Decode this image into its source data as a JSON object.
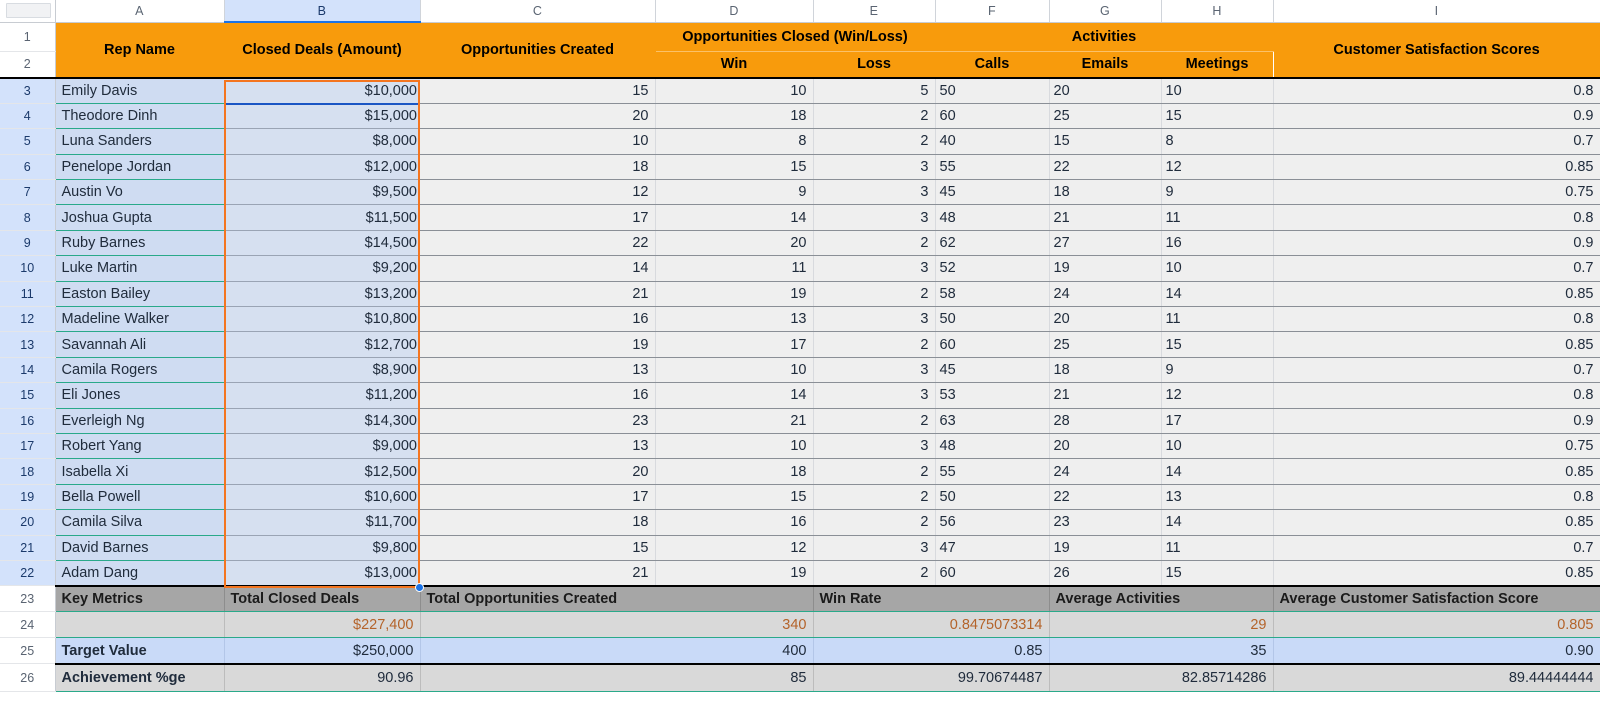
{
  "spreadsheet": {
    "column_letters": [
      "A",
      "B",
      "C",
      "D",
      "E",
      "F",
      "G",
      "H",
      "I"
    ],
    "selected_column": "B",
    "selected_range": "B3:B22",
    "active_cell": "B3",
    "accent_header_color": "#f89b0c",
    "selection_border_color": "#f4751f",
    "active_cell_color": "#1a56c4"
  },
  "headers": {
    "rep_name": "Rep Name",
    "closed_deals": "Closed Deals (Amount)",
    "opportunities_created": "Opportunities Created",
    "opportunities_closed": "Opportunities Closed (Win/Loss)",
    "win": "Win",
    "loss": "Loss",
    "activities": "Activities",
    "calls": "Calls",
    "emails": "Emails",
    "meetings": "Meetings",
    "customer_satisfaction": "Customer Satisfaction Scores"
  },
  "rows": [
    {
      "n": "3",
      "rep": "Emily Davis",
      "amount": "$10,000",
      "opps": "15",
      "win": "10",
      "loss": "5",
      "calls": "50",
      "emails": "20",
      "meetings": "10",
      "csat": "0.8"
    },
    {
      "n": "4",
      "rep": "Theodore Dinh",
      "amount": "$15,000",
      "opps": "20",
      "win": "18",
      "loss": "2",
      "calls": "60",
      "emails": "25",
      "meetings": "15",
      "csat": "0.9"
    },
    {
      "n": "5",
      "rep": "Luna Sanders",
      "amount": "$8,000",
      "opps": "10",
      "win": "8",
      "loss": "2",
      "calls": "40",
      "emails": "15",
      "meetings": "8",
      "csat": "0.7"
    },
    {
      "n": "6",
      "rep": "Penelope Jordan",
      "amount": "$12,000",
      "opps": "18",
      "win": "15",
      "loss": "3",
      "calls": "55",
      "emails": "22",
      "meetings": "12",
      "csat": "0.85"
    },
    {
      "n": "7",
      "rep": "Austin Vo",
      "amount": "$9,500",
      "opps": "12",
      "win": "9",
      "loss": "3",
      "calls": "45",
      "emails": "18",
      "meetings": "9",
      "csat": "0.75"
    },
    {
      "n": "8",
      "rep": "Joshua Gupta",
      "amount": "$11,500",
      "opps": "17",
      "win": "14",
      "loss": "3",
      "calls": "48",
      "emails": "21",
      "meetings": "11",
      "csat": "0.8"
    },
    {
      "n": "9",
      "rep": "Ruby Barnes",
      "amount": "$14,500",
      "opps": "22",
      "win": "20",
      "loss": "2",
      "calls": "62",
      "emails": "27",
      "meetings": "16",
      "csat": "0.9"
    },
    {
      "n": "10",
      "rep": "Luke Martin",
      "amount": "$9,200",
      "opps": "14",
      "win": "11",
      "loss": "3",
      "calls": "52",
      "emails": "19",
      "meetings": "10",
      "csat": "0.7"
    },
    {
      "n": "11",
      "rep": "Easton Bailey",
      "amount": "$13,200",
      "opps": "21",
      "win": "19",
      "loss": "2",
      "calls": "58",
      "emails": "24",
      "meetings": "14",
      "csat": "0.85"
    },
    {
      "n": "12",
      "rep": "Madeline Walker",
      "amount": "$10,800",
      "opps": "16",
      "win": "13",
      "loss": "3",
      "calls": "50",
      "emails": "20",
      "meetings": "11",
      "csat": "0.8"
    },
    {
      "n": "13",
      "rep": "Savannah Ali",
      "amount": "$12,700",
      "opps": "19",
      "win": "17",
      "loss": "2",
      "calls": "60",
      "emails": "25",
      "meetings": "15",
      "csat": "0.85"
    },
    {
      "n": "14",
      "rep": "Camila Rogers",
      "amount": "$8,900",
      "opps": "13",
      "win": "10",
      "loss": "3",
      "calls": "45",
      "emails": "18",
      "meetings": "9",
      "csat": "0.7"
    },
    {
      "n": "15",
      "rep": "Eli Jones",
      "amount": "$11,200",
      "opps": "16",
      "win": "14",
      "loss": "3",
      "calls": "53",
      "emails": "21",
      "meetings": "12",
      "csat": "0.8"
    },
    {
      "n": "16",
      "rep": "Everleigh Ng",
      "amount": "$14,300",
      "opps": "23",
      "win": "21",
      "loss": "2",
      "calls": "63",
      "emails": "28",
      "meetings": "17",
      "csat": "0.9"
    },
    {
      "n": "17",
      "rep": "Robert Yang",
      "amount": "$9,000",
      "opps": "13",
      "win": "10",
      "loss": "3",
      "calls": "48",
      "emails": "20",
      "meetings": "10",
      "csat": "0.75"
    },
    {
      "n": "18",
      "rep": "Isabella Xi",
      "amount": "$12,500",
      "opps": "20",
      "win": "18",
      "loss": "2",
      "calls": "55",
      "emails": "24",
      "meetings": "14",
      "csat": "0.85"
    },
    {
      "n": "19",
      "rep": "Bella Powell",
      "amount": "$10,600",
      "opps": "17",
      "win": "15",
      "loss": "2",
      "calls": "50",
      "emails": "22",
      "meetings": "13",
      "csat": "0.8"
    },
    {
      "n": "20",
      "rep": "Camila Silva",
      "amount": "$11,700",
      "opps": "18",
      "win": "16",
      "loss": "2",
      "calls": "56",
      "emails": "23",
      "meetings": "14",
      "csat": "0.85"
    },
    {
      "n": "21",
      "rep": "David Barnes",
      "amount": "$9,800",
      "opps": "15",
      "win": "12",
      "loss": "3",
      "calls": "47",
      "emails": "19",
      "meetings": "11",
      "csat": "0.7"
    },
    {
      "n": "22",
      "rep": "Adam Dang",
      "amount": "$13,000",
      "opps": "21",
      "win": "19",
      "loss": "2",
      "calls": "60",
      "emails": "26",
      "meetings": "15",
      "csat": "0.85"
    }
  ],
  "summary": {
    "row_numbers": {
      "metrics": "23",
      "actual": "24",
      "target": "25",
      "achievement": "26"
    },
    "metric_labels": {
      "key_metrics": "Key Metrics",
      "total_closed_deals": "Total Closed Deals",
      "total_opportunities_created": "Total Opportunities Created",
      "win_rate": "Win Rate",
      "average_activities": "Average Activities",
      "average_customer_satisfaction": "Average Customer Satisfaction Score"
    },
    "actual": {
      "label": "",
      "total_closed_deals": "$227,400",
      "total_opportunities_created": "340",
      "win_rate": "0.8475073314",
      "average_activities": "29",
      "average_customer_satisfaction": "0.805"
    },
    "target": {
      "label": "Target Value",
      "total_closed_deals": "$250,000",
      "total_opportunities_created": "400",
      "win_rate": "0.85",
      "average_activities": "35",
      "average_customer_satisfaction": "0.90"
    },
    "achievement": {
      "label": "Achievement %ge",
      "total_closed_deals": "90.96",
      "total_opportunities_created": "85",
      "win_rate": "99.70674487",
      "average_activities": "82.85714286",
      "average_customer_satisfaction": "89.44444444"
    }
  }
}
